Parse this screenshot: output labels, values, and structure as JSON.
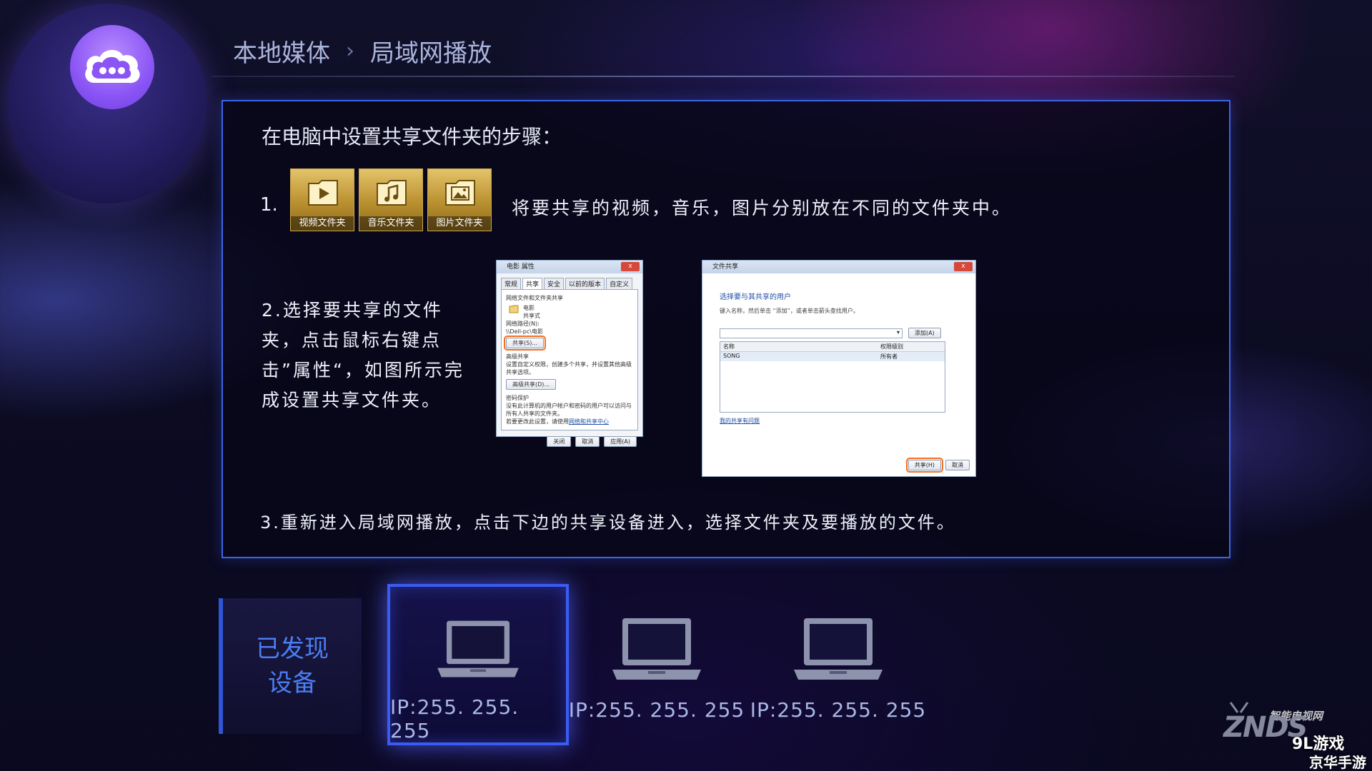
{
  "header": {
    "breadcrumb": [
      "本地媒体",
      "局域网播放"
    ],
    "separator": "›"
  },
  "panel": {
    "title": "在电脑中设置共享文件夹的步骤：",
    "step1": {
      "number": "1.",
      "folders": [
        {
          "icon": "video-play-icon",
          "label": "视频文件夹"
        },
        {
          "icon": "music-note-icon",
          "label": "音乐文件夹"
        },
        {
          "icon": "picture-icon",
          "label": "图片文件夹"
        }
      ],
      "text": "将要共享的视频，音乐，图片分别放在不同的文件夹中。"
    },
    "step2": {
      "text": "2.选择要共享的文件夹，点击鼠标右键点击”属性“，如图所示完成设置共享文件夹。",
      "dialog1": {
        "title": "电影 属性",
        "close": "x",
        "tabs": [
          "常规",
          "共享",
          "安全",
          "以前的版本",
          "自定义"
        ],
        "section1": "网络文件和文件夹共享",
        "folder_name": "电影",
        "share_state": "共享式",
        "path_label": "网络路径(N):",
        "path_value": "\\\\Dell-pc\\电影",
        "share_button": "共享(S)...",
        "section2": "高级共享",
        "section2_desc": "设置自定义权限，创建多个共享，并设置其他高级共享选项。",
        "advanced_button": "高级共享(D)...",
        "section3": "密码保护",
        "section3_desc": "没有此计算机的用户帐户和密码的用户可以访问与所有人共享的文件夹。",
        "section3_link_prefix": "若要更改此设置，请使用",
        "section3_link": "网络和共享中心",
        "footer_buttons": [
          "关闭",
          "取消",
          "应用(A)"
        ]
      },
      "dialog2": {
        "title": "文件共享",
        "heading": "选择要与其共享的用户",
        "sub": "键入名称，然后单击 “添加”，或者单击箭头查找用户。",
        "add_button": "添加(A)",
        "col_name": "名称",
        "col_perm": "权限级别",
        "row_user": "SONG",
        "row_perm": "所有者",
        "link": "我的共享有问题",
        "share_button": "共享(H)",
        "cancel_button": "取消"
      }
    },
    "step3": {
      "text": "3.重新进入局域网播放，点击下边的共享设备进入，选择文件夹及要播放的文件。"
    }
  },
  "devices": {
    "label": "已发现设备",
    "items": [
      {
        "ip": "IP:255. 255. 255",
        "focused": true
      },
      {
        "ip": "IP:255. 255. 255",
        "focused": false
      },
      {
        "ip": "IP:255. 255. 255",
        "focused": false
      }
    ]
  },
  "watermark": {
    "site_label": "智能电视网",
    "brand": "ZNDS",
    "game_site": "9L游戏",
    "game_site_sub": "京华手游"
  },
  "colors": {
    "accent_blue": "#3d64e6",
    "folder_gold": "#d4b050",
    "logo_purple": "#8b55f5",
    "highlight_orange": "#f27020"
  }
}
